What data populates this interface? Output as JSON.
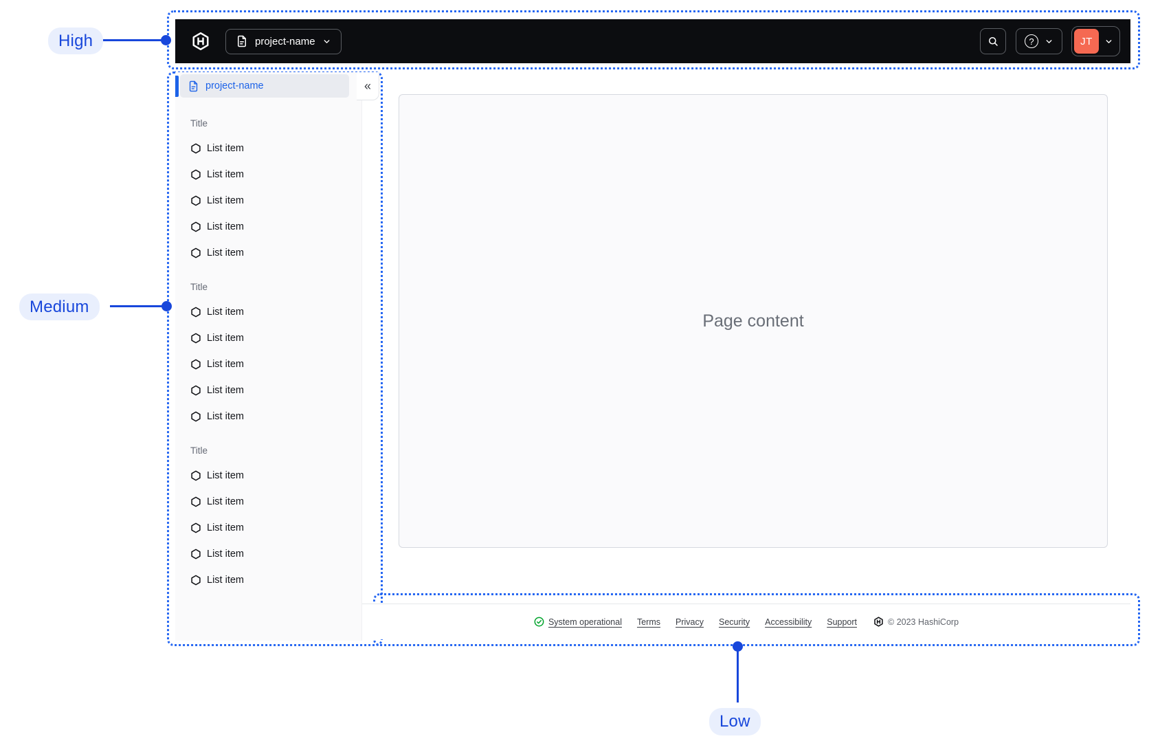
{
  "annotations": {
    "high": {
      "label": "High"
    },
    "medium": {
      "label": "Medium"
    },
    "low": {
      "label": "Low"
    }
  },
  "navbar": {
    "logo_icon": "hashicorp-logo",
    "project_switcher": {
      "icon": "file-text-icon",
      "label": "project-name"
    },
    "search_icon": "search-icon",
    "help_glyph": "?",
    "user_initials": "JT"
  },
  "sidebar": {
    "active_item": {
      "icon": "file-text-icon",
      "label": "project-name"
    },
    "collapse_glyph": "«",
    "sections": [
      {
        "title": "Title",
        "items": [
          "List item",
          "List item",
          "List item",
          "List item",
          "List item"
        ]
      },
      {
        "title": "Title",
        "items": [
          "List item",
          "List item",
          "List item",
          "List item",
          "List item"
        ]
      },
      {
        "title": "Title",
        "items": [
          "List item",
          "List item",
          "List item",
          "List item",
          "List item"
        ]
      }
    ]
  },
  "main": {
    "placeholder": "Page content"
  },
  "footer": {
    "status_label": "System operational",
    "links": [
      "Terms",
      "Privacy",
      "Security",
      "Accessibility",
      "Support"
    ],
    "logo_icon": "hashicorp-logo",
    "copyright": "© 2023 HashiCorp"
  },
  "colors": {
    "annotation_blue": "#1847DB",
    "dotted_border_blue": "#2667F2",
    "navbar_bg": "#0C0D10",
    "avatar_orange": "#F56952",
    "link_blue": "#1C62E8",
    "status_green": "#00A32B"
  }
}
